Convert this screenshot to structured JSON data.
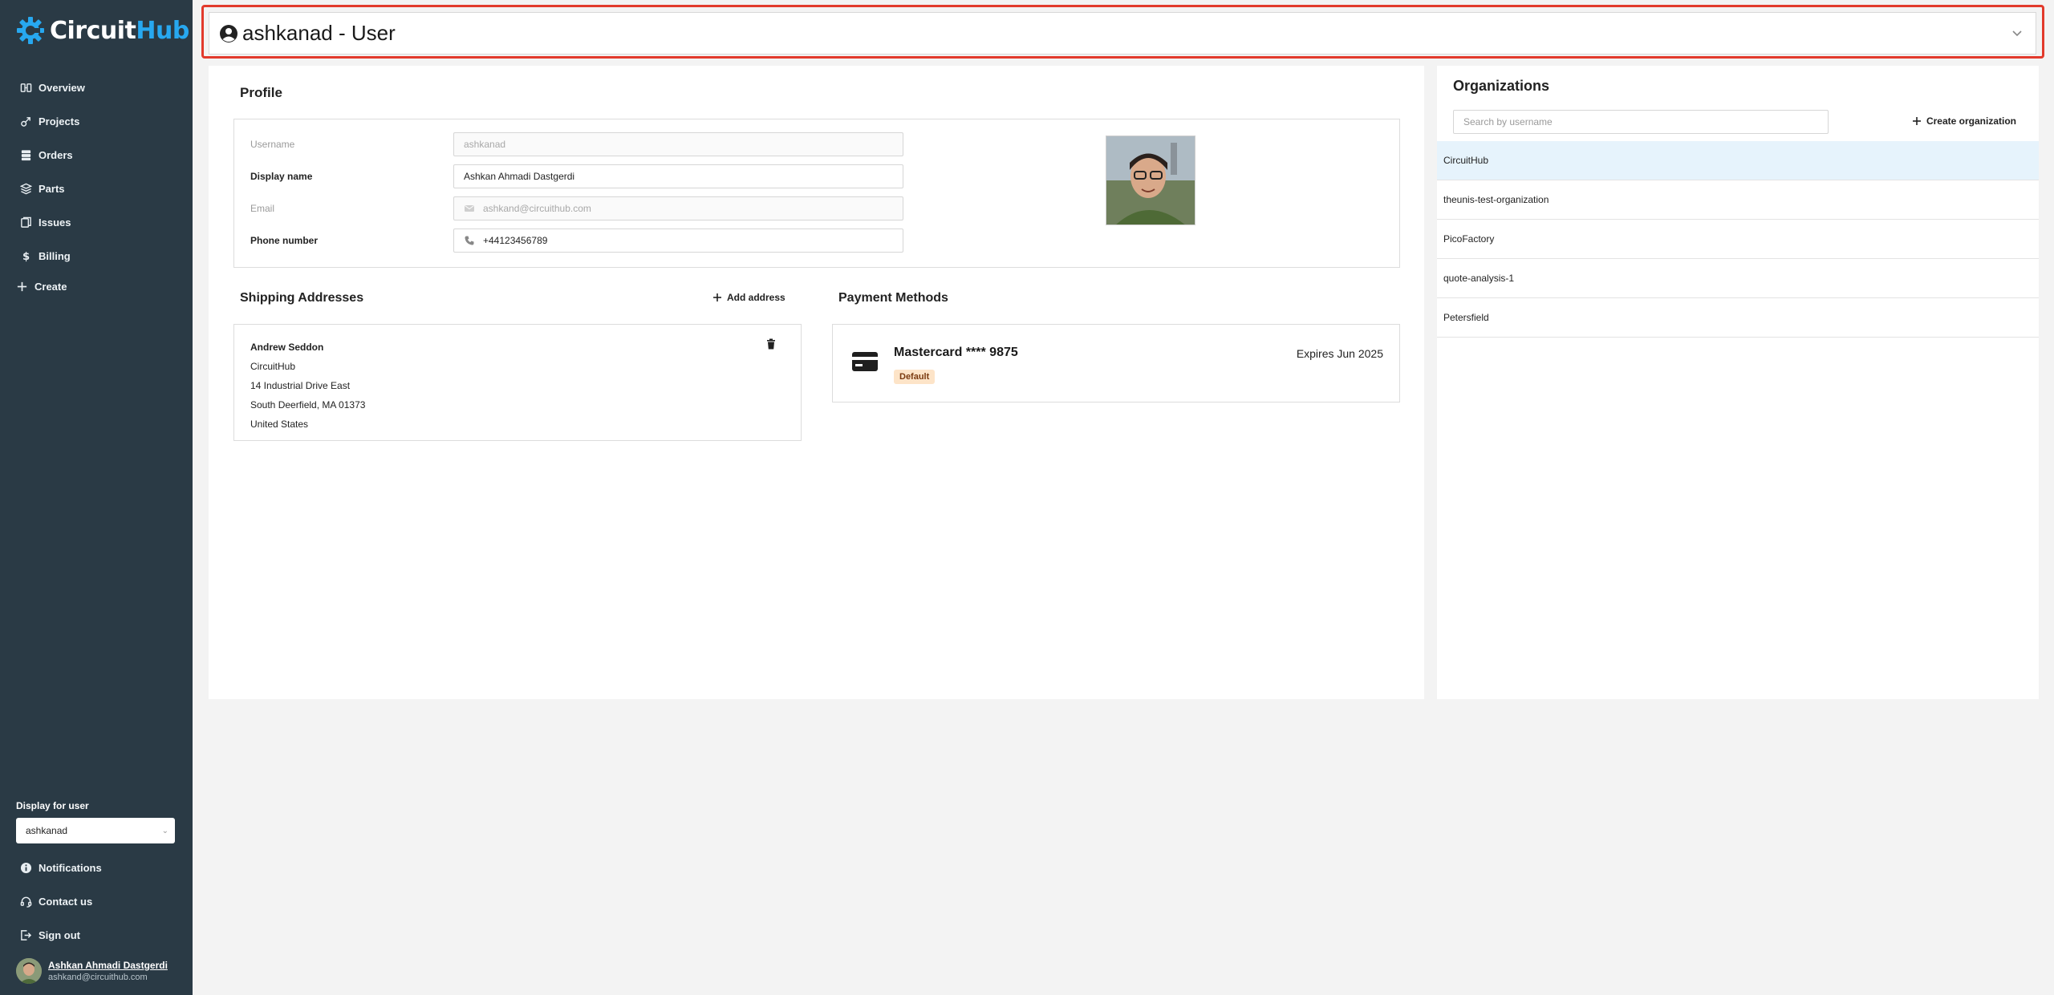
{
  "brand": {
    "circuit": "Circuit",
    "hub": "Hub",
    "accent": "#27a8f0"
  },
  "sidebar": {
    "items": [
      {
        "label": "Overview",
        "icon": "overview-icon"
      },
      {
        "label": "Projects",
        "icon": "projects-icon"
      },
      {
        "label": "Orders",
        "icon": "orders-icon"
      },
      {
        "label": "Parts",
        "icon": "parts-icon"
      },
      {
        "label": "Issues",
        "icon": "issues-icon"
      },
      {
        "label": "Billing",
        "icon": "dollar-icon"
      }
    ],
    "create_label": "Create",
    "display_for_label": "Display for user",
    "display_for_value": "ashkanad",
    "bottom_items": [
      {
        "label": "Notifications",
        "icon": "info-icon"
      },
      {
        "label": "Contact us",
        "icon": "headset-icon"
      },
      {
        "label": "Sign out",
        "icon": "sign-out-icon"
      }
    ],
    "user": {
      "name": "Ashkan Ahmadi Dastgerdi",
      "email": "ashkand@circuithub.com"
    }
  },
  "header": {
    "title": "ashkanad - User"
  },
  "profile": {
    "title": "Profile",
    "fields": [
      {
        "label": "Username",
        "value": "ashkanad"
      },
      {
        "label": "Display name",
        "value": "Ashkan Ahmadi Dastgerdi"
      },
      {
        "label": "Email",
        "value": "ashkand@circuithub.com"
      },
      {
        "label": "Phone number",
        "value": "+44123456789"
      }
    ]
  },
  "shipping": {
    "title": "Shipping Addresses",
    "add_label": "Add address",
    "address": {
      "name": "Andrew Seddon",
      "company": "CircuitHub",
      "street": "14 Industrial Drive East",
      "city": "South Deerfield, MA 01373",
      "country": "United States"
    }
  },
  "payment": {
    "title": "Payment Methods",
    "card": "Mastercard **** 9875",
    "badge": "Default",
    "expires": "Expires Jun 2025"
  },
  "organizations": {
    "title": "Organizations",
    "search_placeholder": "Search by username",
    "create_label": "Create organization",
    "items": [
      "CircuitHub",
      "theunis-test-organization",
      "PicoFactory",
      "quote-analysis-1",
      "Petersfield"
    ]
  }
}
